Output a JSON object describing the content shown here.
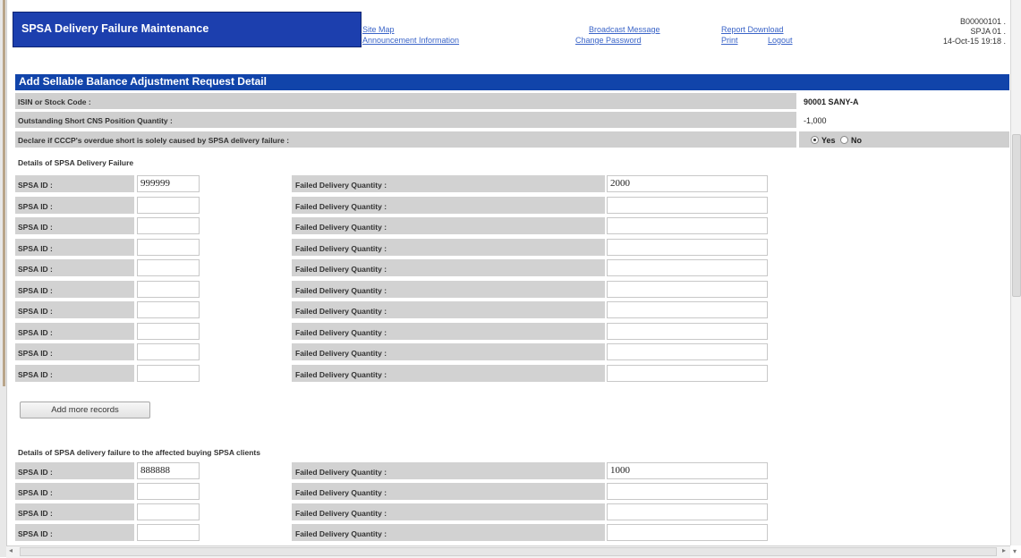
{
  "header": {
    "title": "SPSA Delivery Failure Maintenance",
    "links": {
      "site_map": "Site Map",
      "announcement": "Announcement Information",
      "broadcast": "Broadcast Message",
      "change_password": "Change Password",
      "report_download": "Report Download",
      "print": "Print",
      "logout": "Logout"
    },
    "info": {
      "user_id": "B00000101 .",
      "role": "SPJA 01 .",
      "datetime": "14-Oct-15 19:18 ."
    }
  },
  "section": {
    "title": "Add Sellable Balance Adjustment Request Detail",
    "isin_label": "ISIN or Stock Code :",
    "isin_value": "90001 SANY-A",
    "short_label": "Outstanding Short CNS Position Quantity :",
    "short_value": "-1,000",
    "declare_label": "Declare if CCCP's overdue short is solely caused by SPSA delivery failure :",
    "declare_yes": "Yes",
    "declare_no": "No"
  },
  "delivery_failure": {
    "heading": "Details of SPSA Delivery Failure",
    "spsa_label": "SPSA ID :",
    "qty_label": "Failed Delivery Quantity :",
    "rows": [
      {
        "spsa_id": "999999",
        "qty": "2000"
      },
      {
        "spsa_id": "",
        "qty": ""
      },
      {
        "spsa_id": "",
        "qty": ""
      },
      {
        "spsa_id": "",
        "qty": ""
      },
      {
        "spsa_id": "",
        "qty": ""
      },
      {
        "spsa_id": "",
        "qty": ""
      },
      {
        "spsa_id": "",
        "qty": ""
      },
      {
        "spsa_id": "",
        "qty": ""
      },
      {
        "spsa_id": "",
        "qty": ""
      },
      {
        "spsa_id": "",
        "qty": ""
      }
    ],
    "add_button": "Add more records"
  },
  "buying_clients": {
    "heading": "Details of SPSA delivery failure to the affected buying SPSA clients",
    "spsa_label": "SPSA ID :",
    "qty_label": "Failed Delivery Quantity :",
    "rows": [
      {
        "spsa_id": "888888",
        "qty": "1000"
      },
      {
        "spsa_id": "",
        "qty": ""
      },
      {
        "spsa_id": "",
        "qty": ""
      },
      {
        "spsa_id": "",
        "qty": ""
      }
    ]
  }
}
